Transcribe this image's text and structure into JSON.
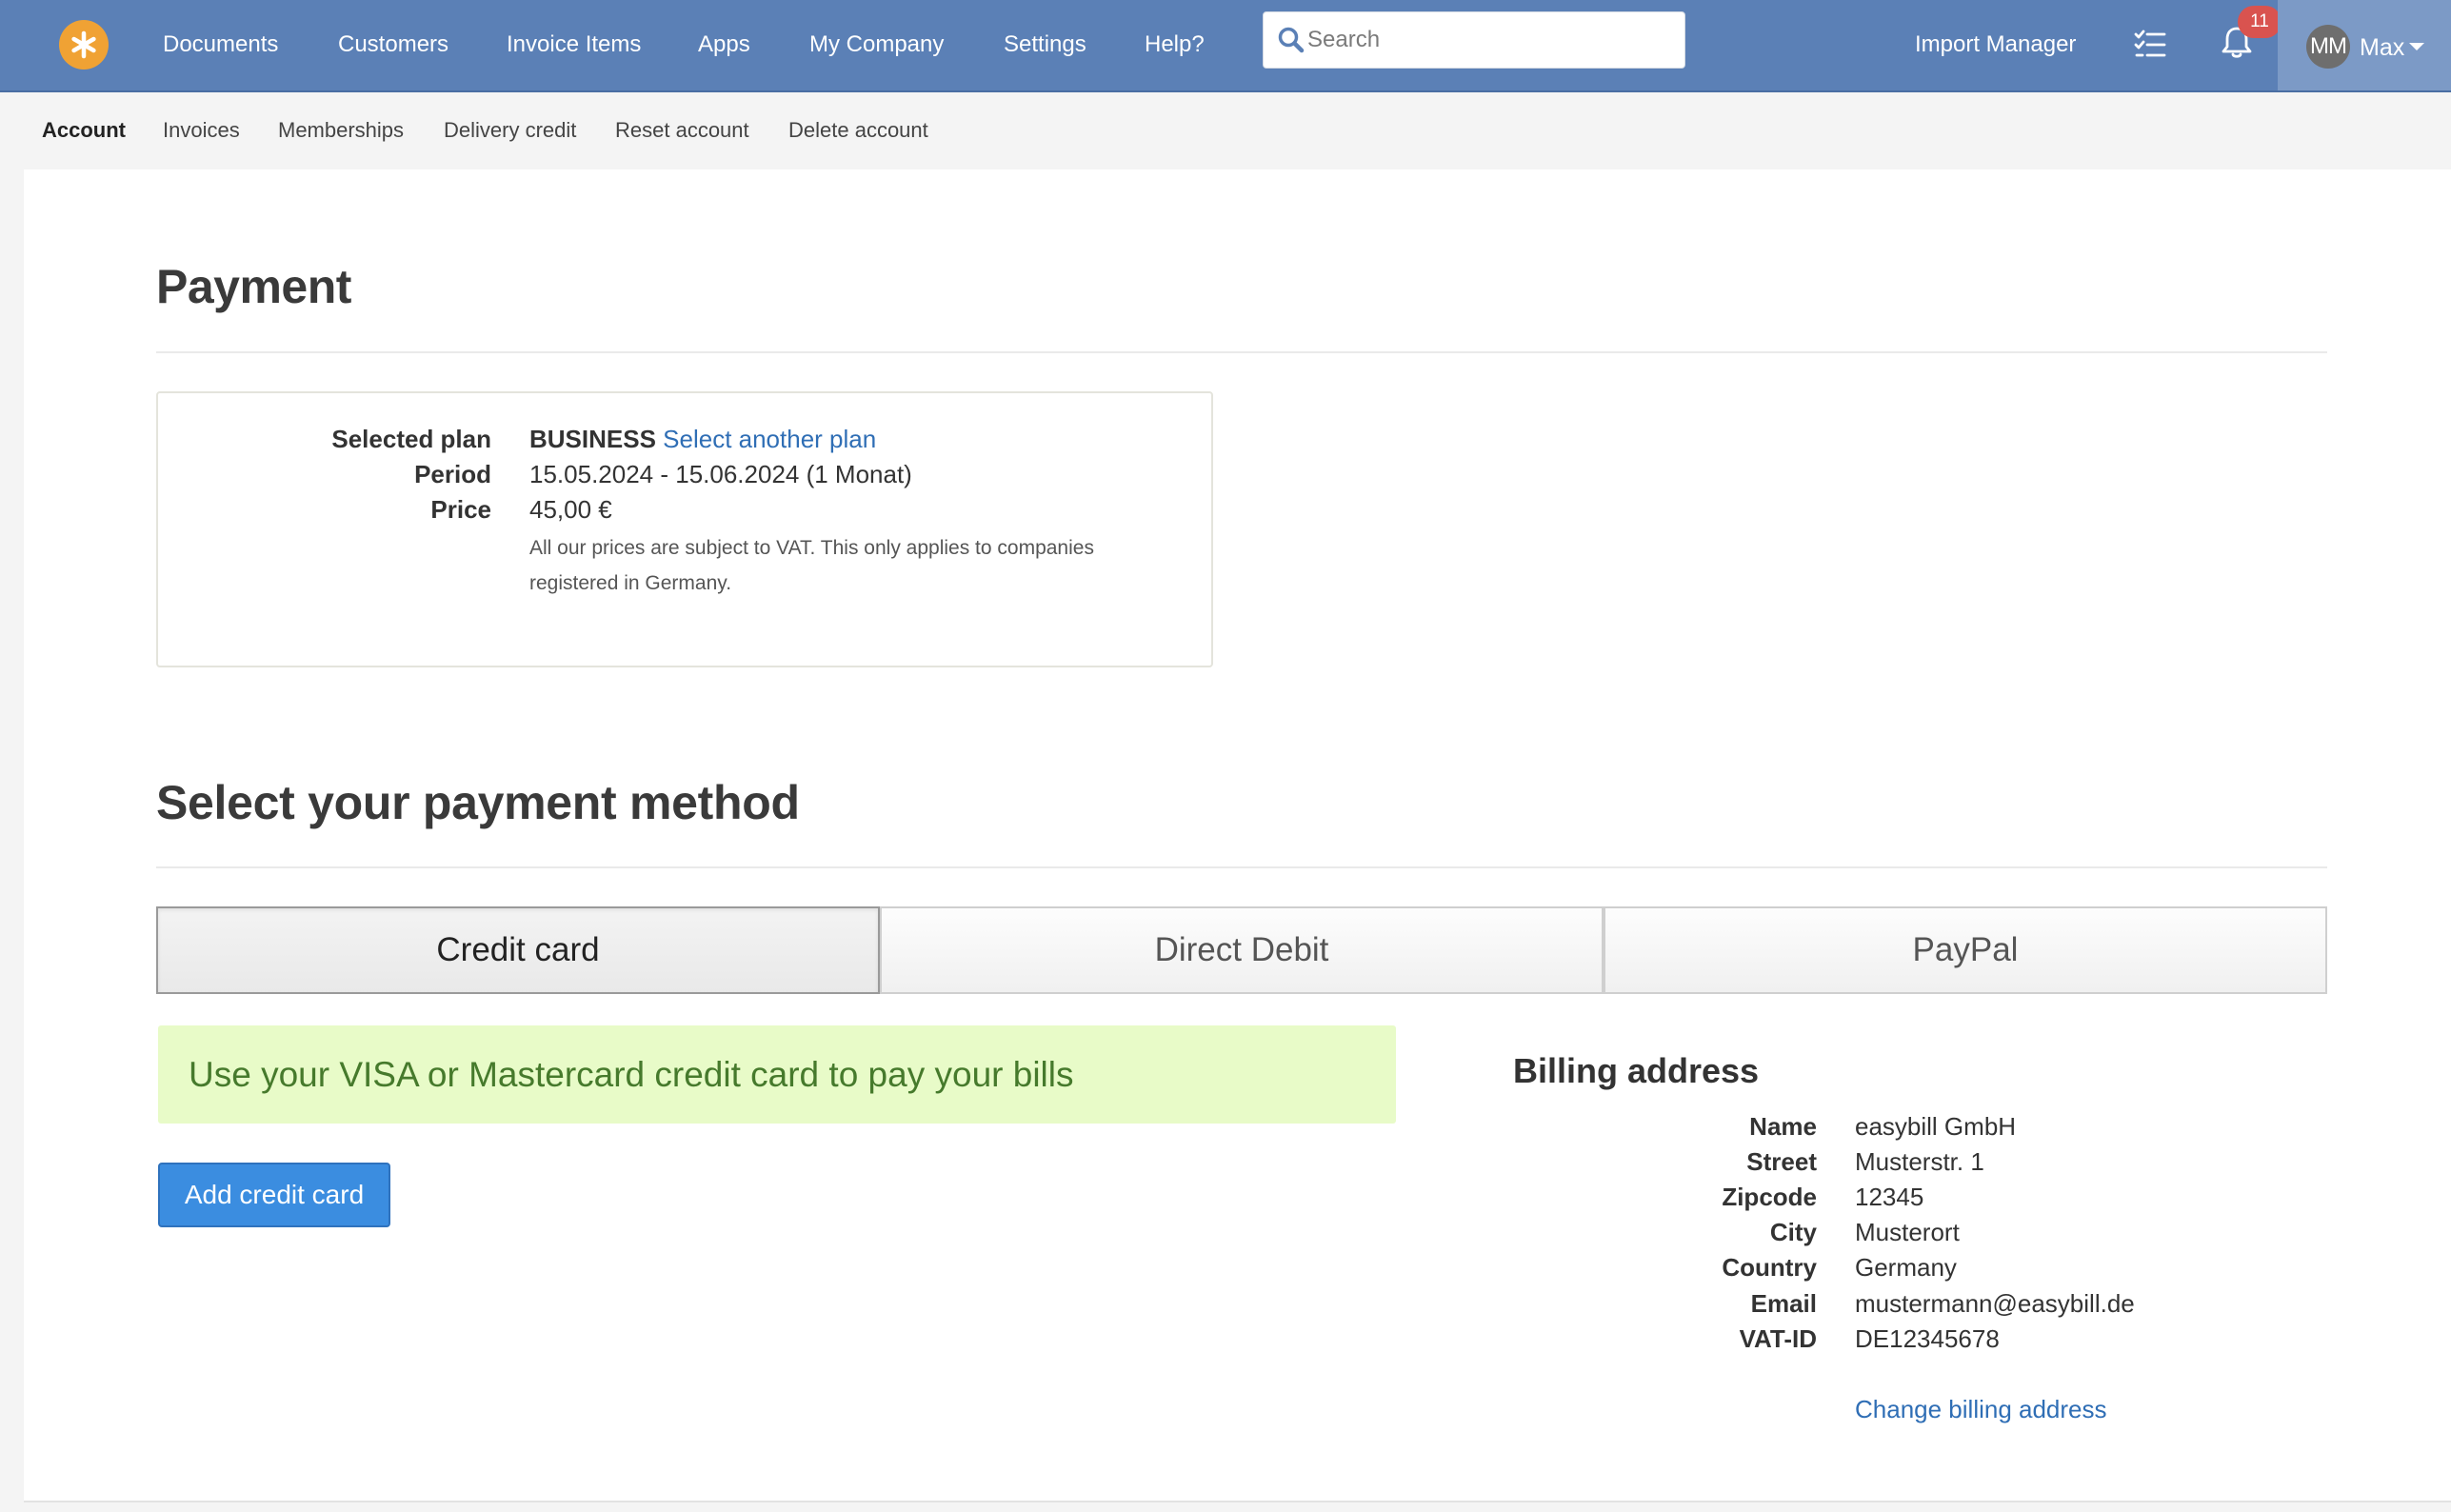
{
  "app": {
    "logo_icon": "asterisk-logo-icon",
    "accent_color": "#5b80b6",
    "logo_color": "#f0a234"
  },
  "nav": {
    "items": [
      {
        "label": "Documents"
      },
      {
        "label": "Customers"
      },
      {
        "label": "Invoice Items"
      },
      {
        "label": "Apps"
      },
      {
        "label": "My Company"
      },
      {
        "label": "Settings"
      },
      {
        "label": "Help?"
      }
    ],
    "search_placeholder": "Search",
    "import_manager": "Import Manager",
    "notification_count": "11",
    "user_initials": "MM",
    "user_name": "Max"
  },
  "subnav": {
    "items": [
      {
        "label": "Account",
        "active": true
      },
      {
        "label": "Invoices",
        "active": false
      },
      {
        "label": "Memberships",
        "active": false
      },
      {
        "label": "Delivery credit",
        "active": false
      },
      {
        "label": "Reset account",
        "active": false
      },
      {
        "label": "Delete account",
        "active": false
      }
    ]
  },
  "payment": {
    "title": "Payment",
    "plan_label": "Selected plan",
    "plan_value": "BUSINESS",
    "plan_link": "Select another plan",
    "period_label": "Period",
    "period_value": "15.05.2024 - 15.06.2024 (1 Monat)",
    "price_label": "Price",
    "price_value": "45,00 €",
    "vat_note": "All our prices are subject to VAT. This only applies to companies registered in Germany."
  },
  "method": {
    "title": "Select your payment method",
    "tabs": [
      {
        "label": "Credit card",
        "active": true
      },
      {
        "label": "Direct Debit",
        "active": false
      },
      {
        "label": "PayPal",
        "active": false
      }
    ],
    "alert": "Use your VISA or Mastercard credit card to pay your bills",
    "add_button": "Add credit card",
    "alert_bg": "#e8fbc8",
    "button_color": "#3b8de0"
  },
  "billing": {
    "title": "Billing address",
    "rows": [
      {
        "label": "Name",
        "value": "easybill GmbH"
      },
      {
        "label": "Street",
        "value": "Musterstr. 1"
      },
      {
        "label": "Zipcode",
        "value": "12345"
      },
      {
        "label": "City",
        "value": "Musterort"
      },
      {
        "label": "Country",
        "value": "Germany"
      },
      {
        "label": "Email",
        "value": "mustermann@easybill.de"
      },
      {
        "label": "VAT-ID",
        "value": "DE12345678"
      }
    ],
    "change_link": "Change billing address"
  }
}
